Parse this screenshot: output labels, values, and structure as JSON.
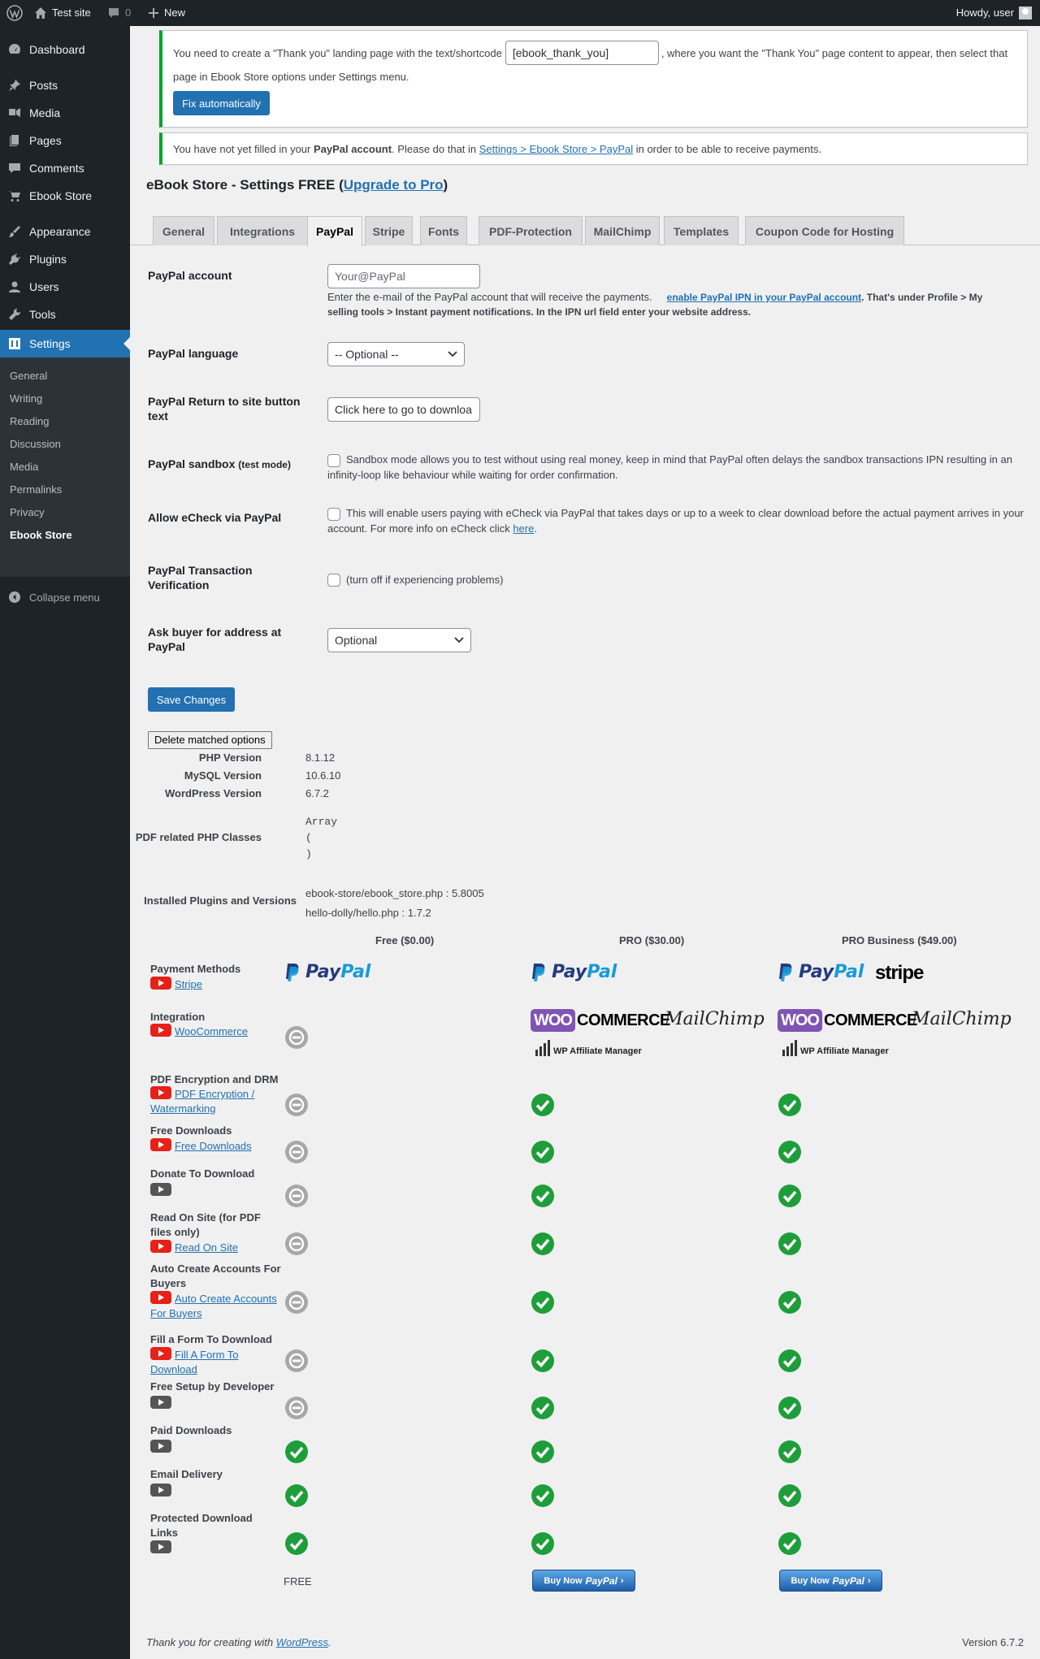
{
  "adminbar": {
    "site_name": "Test site",
    "comments_count": "0",
    "new_label": "New",
    "howdy": "Howdy, user"
  },
  "sidebar": {
    "items": [
      {
        "label": "Dashboard",
        "icon": "dashboard-icon"
      },
      {
        "label": "Posts",
        "icon": "pin-icon"
      },
      {
        "label": "Media",
        "icon": "media-icon"
      },
      {
        "label": "Pages",
        "icon": "pages-icon"
      },
      {
        "label": "Comments",
        "icon": "comment-icon"
      },
      {
        "label": "Ebook Store",
        "icon": "cart-icon"
      },
      {
        "label": "Appearance",
        "icon": "brush-icon"
      },
      {
        "label": "Plugins",
        "icon": "plug-icon"
      },
      {
        "label": "Users",
        "icon": "user-icon"
      },
      {
        "label": "Tools",
        "icon": "wrench-icon"
      },
      {
        "label": "Settings",
        "icon": "settings-icon"
      }
    ],
    "submenu": [
      "General",
      "Writing",
      "Reading",
      "Discussion",
      "Media",
      "Permalinks",
      "Privacy",
      "Ebook Store"
    ],
    "collapse_label": "Collapse menu"
  },
  "notices": {
    "thankyou_before": "You need to create a \"Thank you\" landing page with the text/shortcode",
    "shortcode_value": "[ebook_thank_you]",
    "thankyou_after": ", where you want the \"Thank You\" page content to appear, then select that",
    "thankyou_line2": "page in Ebook Store options under Settings menu.",
    "fix_button": "Fix automatically",
    "paypal_before": "You have not yet filled in your ",
    "paypal_bold": "PayPal account",
    "paypal_mid": ". Please do that in ",
    "paypal_link": "Settings > Ebook Store > PayPal",
    "paypal_after": " in order to be able to receive payments."
  },
  "page": {
    "title_prefix": "eBook Store - Settings FREE (",
    "title_link": "Upgrade to Pro",
    "title_suffix": ")"
  },
  "tabs": [
    "General",
    "Integrations",
    "PayPal",
    "Stripe",
    "Fonts",
    "PDF-Protection",
    "MailChimp",
    "Templates",
    "Coupon Code for Hosting"
  ],
  "form": {
    "paypal_account_label": "PayPal account",
    "paypal_account_placeholder": "Your@PayPal",
    "paypal_account_desc1": "Enter the e-mail of the PayPal account that will receive the payments.",
    "paypal_account_ipn_link": "enable PayPal IPN in your PayPal account",
    "paypal_account_desc2": ". That's under Profile > My",
    "paypal_account_desc3": "selling tools > Instant payment notifications. In the IPN url field enter your website address.",
    "language_label": "PayPal language",
    "language_value": "-- Optional --",
    "return_label": "PayPal Return to site button text",
    "return_value": "Click here to go to downloa",
    "sandbox_label": "PayPal sandbox",
    "sandbox_small": "(test mode)",
    "sandbox_desc": "Sandbox mode allows you to test without using real money, keep in mind that PayPal often delays the sandbox transactions IPN resulting in an infinity-loop like behaviour while waiting for order confirmation.",
    "echeck_label": "Allow eCheck via PayPal",
    "echeck_desc": "This will enable users paying with eCheck via PayPal that takes days or up to a week to clear download before the actual payment arrives in your account. For more info on eCheck click ",
    "echeck_link": "here",
    "echeck_end": ".",
    "verify_label": "PayPal Transaction Verification",
    "verify_desc": "(turn off if experiencing problems)",
    "address_label": "Ask buyer for address at PayPal",
    "address_value": "Optional",
    "save_button": "Save Changes"
  },
  "sysinfo": {
    "delete_button": "Delete matched options",
    "php_label": "PHP Version",
    "php_value": "8.1.12",
    "mysql_label": "MySQL Version",
    "mysql_value": "10.6.10",
    "wp_label": "WordPress Version",
    "wp_value": "6.7.2",
    "pdf_label": "PDF related PHP Classes",
    "pdf_lines": [
      "Array",
      "(",
      ")"
    ],
    "plugins_label": "Installed Plugins and Versions",
    "plugins": [
      "ebook-store/ebook_store.php : 5.8005",
      "hello-dolly/hello.php : 1.7.2"
    ]
  },
  "comparison": {
    "headers": [
      "Free ($0.00)",
      "PRO ($30.00)",
      "PRO Business ($49.00)"
    ],
    "logos": {
      "paypal_a": "Pay",
      "paypal_b": "Pal",
      "stripe": "stripe",
      "woo": "WOO",
      "commerce": "COMMERCE",
      "mailchimp": "MailChimp",
      "wpam": "WP Affiliate Manager"
    },
    "features": [
      {
        "label": "Payment Methods",
        "link": "Stripe",
        "free": "paypal",
        "pro": "paypal",
        "biz": "paypal-stripe"
      },
      {
        "label": "Integration",
        "link": "WooCommerce",
        "free": "minus",
        "pro": "logos",
        "biz": "logos"
      },
      {
        "label": "PDF Encryption and DRM",
        "link": "PDF Encryption / Watermarking",
        "free": "minus",
        "pro": "check",
        "biz": "check"
      },
      {
        "label": "Free Downloads",
        "link": "Free Downloads",
        "free": "minus",
        "pro": "check",
        "biz": "check"
      },
      {
        "label": "Donate To Download",
        "link": "",
        "free": "minus",
        "pro": "check",
        "biz": "check"
      },
      {
        "label": "Read On Site (for PDF files only)",
        "link": "Read On Site",
        "free": "minus",
        "pro": "check",
        "biz": "check"
      },
      {
        "label": "Auto Create Accounts For Buyers",
        "link": "Auto Create Accounts For Buyers",
        "free": "minus",
        "pro": "check",
        "biz": "check"
      },
      {
        "label": "Fill a Form To Download",
        "link": "Fill A Form To Download",
        "free": "minus",
        "pro": "check",
        "biz": "check"
      },
      {
        "label": "Free Setup by Developer",
        "link": "",
        "free": "minus",
        "pro": "check",
        "biz": "check"
      },
      {
        "label": "Paid Downloads",
        "link": "",
        "free": "check",
        "pro": "check",
        "biz": "check"
      },
      {
        "label": "Email Delivery",
        "link": "",
        "free": "check",
        "pro": "check",
        "biz": "check"
      },
      {
        "label": "Protected Download Links",
        "link": "",
        "free": "check",
        "pro": "check",
        "biz": "check"
      }
    ],
    "free_price_text": "FREE",
    "buynow_text": "Buy Now",
    "buynow_brand": "PayPal",
    "buynow_arrow": "›"
  },
  "footer": {
    "thanks_prefix": "Thank you for creating with ",
    "thanks_link": "WordPress",
    "thanks_suffix": ".",
    "version": "Version 6.7.2"
  },
  "colors": {
    "accent": "#2271b1",
    "sidebar": "#1d2327",
    "check": "#1e9e3a",
    "minus": "#a7a7a7",
    "notice_border": "#00a32a"
  }
}
